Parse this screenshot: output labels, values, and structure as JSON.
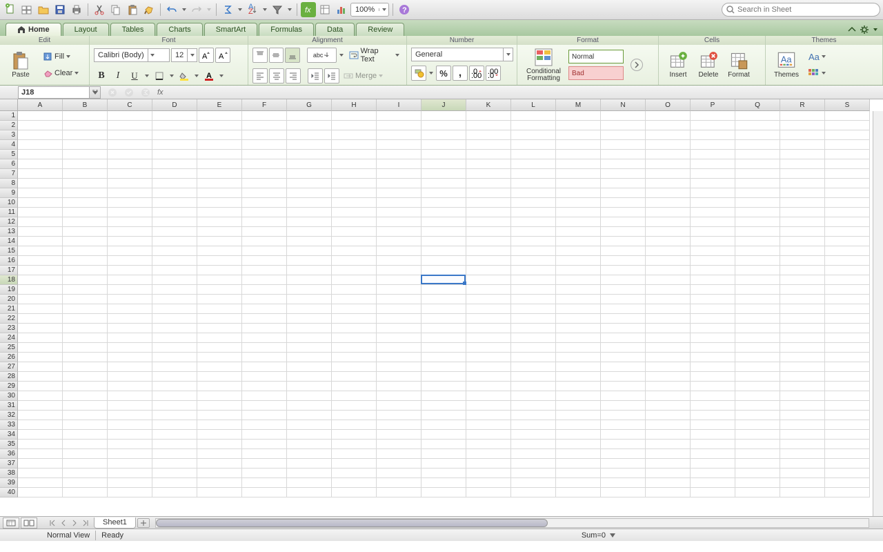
{
  "toolbar": {
    "zoom": "100%",
    "search_placeholder": "Search in Sheet"
  },
  "tabs": {
    "items": [
      "Home",
      "Layout",
      "Tables",
      "Charts",
      "SmartArt",
      "Formulas",
      "Data",
      "Review"
    ],
    "active": 0
  },
  "ribbon": {
    "edit": {
      "title": "Edit",
      "paste": "Paste",
      "fill": "Fill",
      "clear": "Clear"
    },
    "font": {
      "title": "Font",
      "name": "Calibri (Body)",
      "size": "12"
    },
    "alignment": {
      "title": "Alignment",
      "abc": "abc",
      "wrap": "Wrap Text",
      "merge": "Merge"
    },
    "number": {
      "title": "Number",
      "format": "General"
    },
    "format": {
      "title": "Format",
      "cond": "Conditional\nFormatting",
      "style_normal": "Normal",
      "style_bad": "Bad"
    },
    "cells": {
      "title": "Cells",
      "insert": "Insert",
      "delete": "Delete",
      "format": "Format"
    },
    "themes": {
      "title": "Themes",
      "themes": "Themes",
      "aa": "Aa"
    }
  },
  "namebox": {
    "cell": "J18",
    "fx": "fx"
  },
  "columns": [
    "A",
    "B",
    "C",
    "D",
    "E",
    "F",
    "G",
    "H",
    "I",
    "J",
    "K",
    "L",
    "M",
    "N",
    "O",
    "P",
    "Q",
    "R",
    "S"
  ],
  "rows_count": 40,
  "selected": {
    "col": "J",
    "row": 18,
    "col_index": 9
  },
  "sheet_bar": {
    "sheet": "Sheet1"
  },
  "status": {
    "view": "Normal View",
    "ready": "Ready",
    "sum": "Sum=0"
  }
}
